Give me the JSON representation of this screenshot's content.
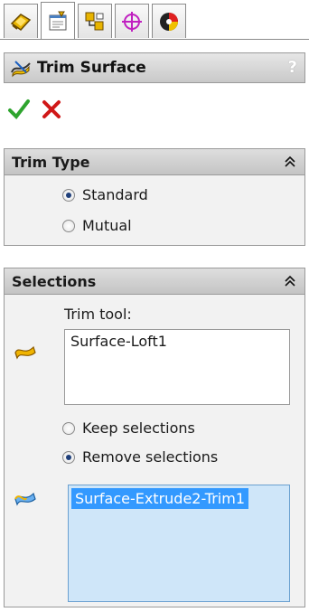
{
  "tabs": [
    {
      "name": "feature-manager"
    },
    {
      "name": "property-manager"
    },
    {
      "name": "configuration-manager"
    },
    {
      "name": "dimxpert-manager"
    },
    {
      "name": "display-manager"
    }
  ],
  "feature": {
    "title": "Trim Surface",
    "help": "?"
  },
  "trim_type": {
    "header": "Trim Type",
    "options": [
      "Standard",
      "Mutual"
    ],
    "selected": "Standard"
  },
  "selections": {
    "header": "Selections",
    "trim_tool_label": "Trim tool:",
    "trim_tool_items": [
      "Surface-Loft1"
    ],
    "keep_label": "Keep selections",
    "remove_label": "Remove selections",
    "selected_option": "Remove selections",
    "pieces_items": [
      "Surface-Extrude2-Trim1"
    ]
  }
}
